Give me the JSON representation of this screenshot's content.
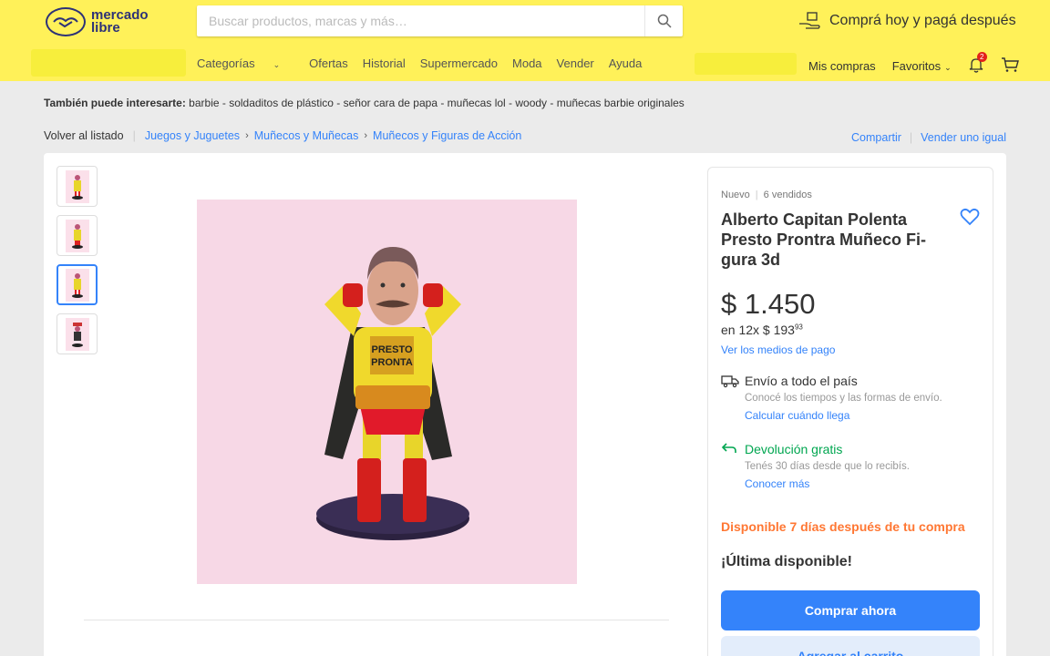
{
  "brand": {
    "line1": "mercado",
    "line2": "libre",
    "icon": "handshake-icon"
  },
  "search": {
    "placeholder": "Buscar productos, marcas y más…",
    "icon": "search-icon"
  },
  "promo": {
    "text": "Comprá hoy y pagá después",
    "icon": "hand-box-icon"
  },
  "nav": {
    "categories": "Categorías",
    "items": [
      "Ofertas",
      "Historial",
      "Supermercado",
      "Moda",
      "Vender",
      "Ayuda"
    ]
  },
  "user_nav": {
    "purchases": "Mis compras",
    "favorites": "Favoritos",
    "notification_count": "2"
  },
  "related": {
    "label": "También puede interesarte:",
    "items": "barbie - soldaditos de plástico - señor cara de papa - muñecas lol - woody - muñecas barbie originales"
  },
  "breadcrumb": {
    "back": "Volver al listado",
    "levels": [
      "Juegos y Juguetes",
      "Muñecos y Muñecas",
      "Muñecos y Figuras de Acción"
    ]
  },
  "actions": {
    "share": "Compartir",
    "sell_same": "Vender uno igual"
  },
  "product": {
    "condition": "Nuevo",
    "sold": "6 vendidos",
    "title": "Alberto Capitan Polenta Presto Prontra Muñeco Fi-gura 3d",
    "price": "$ 1.450",
    "installments": "en 12x $ 193",
    "installments_cents": "93",
    "payment_link": "Ver los medios de pago",
    "shipping_title": "Envío a todo el país",
    "shipping_sub": "Conocé los tiempos y las formas de envío.",
    "shipping_link": "Calcular cuándo llega",
    "return_title": "Devolución gratis",
    "return_sub": "Tenés 30 días desde que lo recibís.",
    "return_link": "Conocer más",
    "availability": "Disponible 7 días después de tu compra",
    "stock": "¡Última disponible!",
    "buy_now": "Comprar ahora",
    "add_to_cart": "Agregar al carrito"
  },
  "colors": {
    "header": "#fff159",
    "accent": "#3483fa",
    "green": "#00a650",
    "orange": "#ff7733"
  }
}
